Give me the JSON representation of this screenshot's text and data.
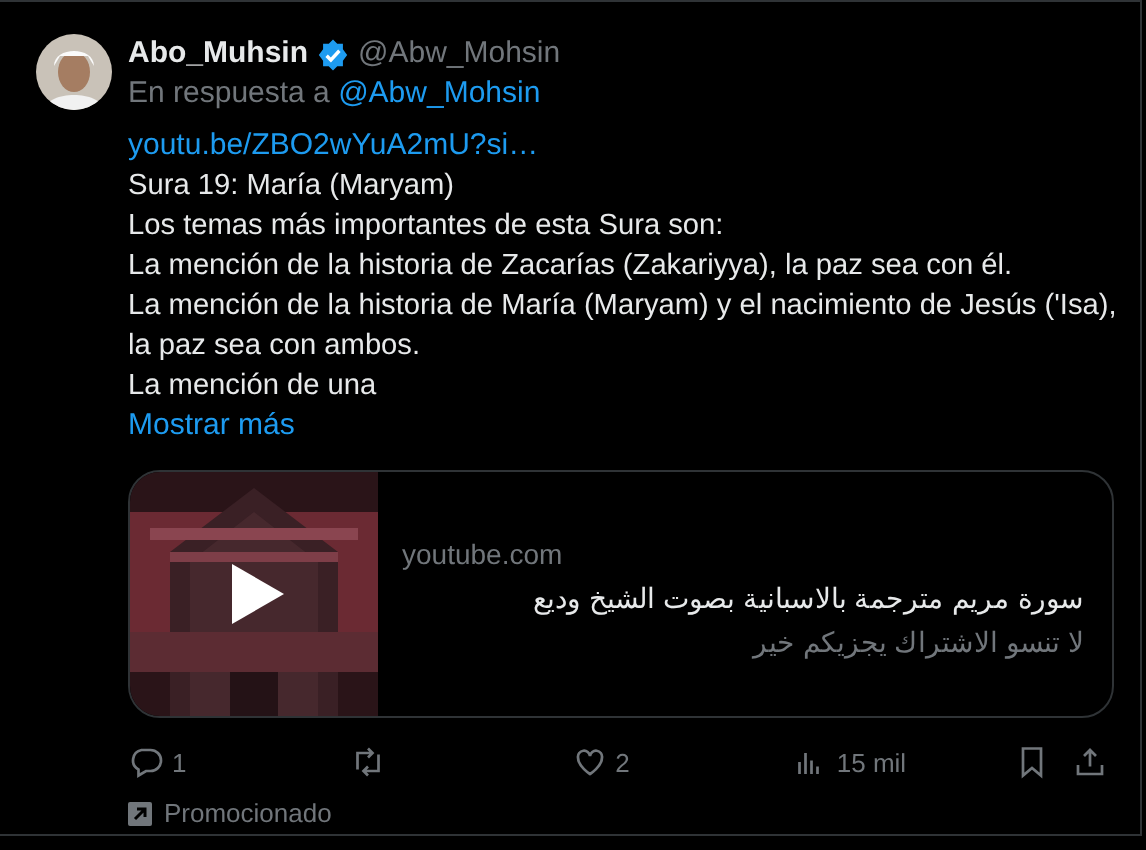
{
  "post": {
    "author": "Abo_Muhsin",
    "verified": true,
    "handle": "@Abw_Mohsin",
    "reply_prefix": "En respuesta a",
    "reply_to": "@Abw_Mohsin",
    "link": "youtu.be/ZBO2wYuA2mU?si…",
    "lines": [
      "Sura 19: María (Maryam)",
      "Los temas más importantes de esta Sura son:",
      "La mención de la historia de Zacarías (Zakariyya), la paz sea con él.",
      "La mención de la historia de María (Maryam) y el nacimiento de Jesús ('Isa), la paz sea con ambos.",
      "La mención de una"
    ],
    "show_more": "Mostrar más",
    "card": {
      "domain": "youtube.com",
      "title": "سورة مريم مترجمة بالاسبانية بصوت الشيخ وديع",
      "description": "لا تنسو الاشتراك يجزيكم خير"
    },
    "actions": [
      {
        "kind": "reply",
        "count": "1"
      },
      {
        "kind": "repost"
      },
      {
        "kind": "like",
        "count": "2"
      },
      {
        "kind": "views",
        "count": "15 mil"
      },
      {
        "kind": "bookmark"
      },
      {
        "kind": "share"
      }
    ],
    "promoted": "Promocionado"
  }
}
